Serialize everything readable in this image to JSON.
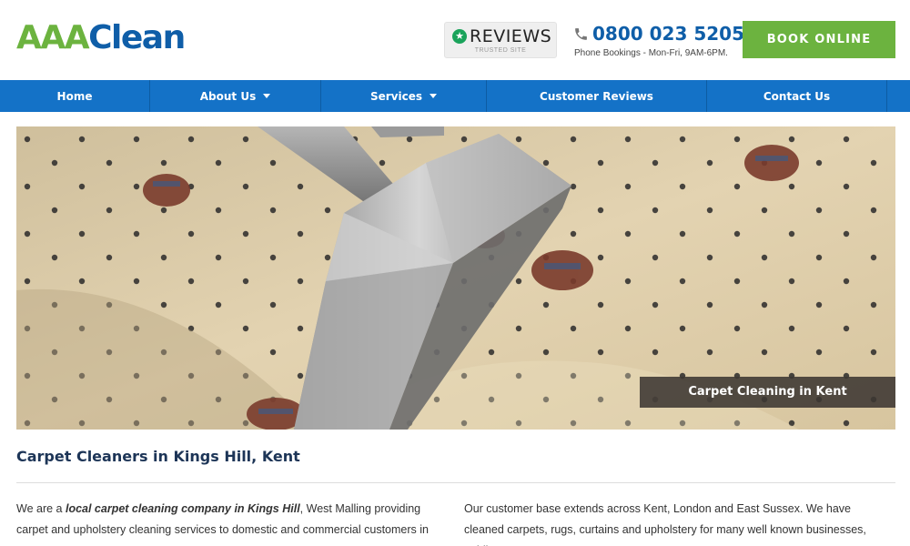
{
  "header": {
    "logo_part1": "AAA",
    "logo_part2": "Clean",
    "reviews_label": "REVIEWS",
    "reviews_sub": "TRUSTED SITE",
    "phone_number": "0800 023 5205",
    "phone_hours": "Phone Bookings - Mon-Fri, 9AM-6PM.",
    "book_label": "BOOK ONLINE"
  },
  "nav": {
    "items": [
      {
        "label": "Home"
      },
      {
        "label": "About Us"
      },
      {
        "label": "Services"
      },
      {
        "label": "Customer Reviews"
      },
      {
        "label": "Contact Us"
      }
    ]
  },
  "hero": {
    "caption": "Carpet Cleaning in Kent"
  },
  "main": {
    "heading": "Carpet Cleaners in Kings Hill, Kent",
    "left_text_a": "We are a ",
    "left_text_em": "local carpet cleaning company in Kings Hill",
    "left_text_b": ", West Malling providing carpet and upholstery cleaning services to domestic and commercial customers in",
    "right_text": "Our customer base extends across Kent, London and East Sussex. We have cleaned carpets, rugs, curtains and upholstery for many well known businesses, public"
  },
  "colors": {
    "brand_green": "#6cb33f",
    "brand_blue": "#0f5ea8",
    "nav_blue": "#1472c7",
    "heading_navy": "#1d3557"
  }
}
